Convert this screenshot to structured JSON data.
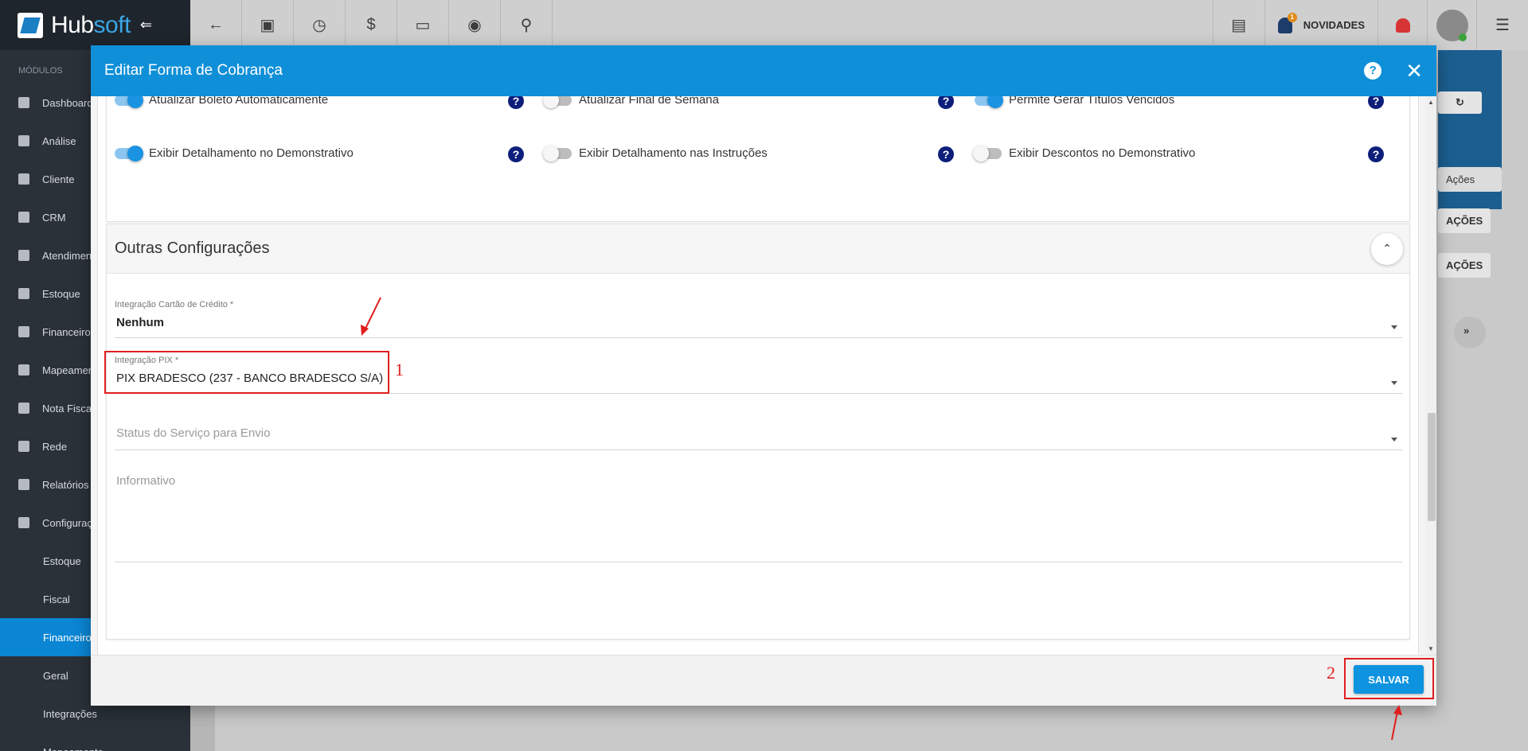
{
  "app": {
    "name_part1": "Hub",
    "name_part2": "soft"
  },
  "sidebar": {
    "section_title": "MÓDULOS",
    "items": [
      {
        "label": "Dashboard",
        "icon": "grid-icon"
      },
      {
        "label": "Análise",
        "icon": "chart-pie-icon"
      },
      {
        "label": "Cliente",
        "icon": "contact-card-icon"
      },
      {
        "label": "CRM",
        "icon": "crm-icon"
      },
      {
        "label": "Atendimento",
        "icon": "calendar-clock-icon"
      },
      {
        "label": "Estoque",
        "icon": "box-icon"
      },
      {
        "label": "Financeiro",
        "icon": "money-icon"
      },
      {
        "label": "Mapeamento",
        "icon": "map-pin-icon"
      },
      {
        "label": "Nota Fiscal",
        "icon": "invoice-icon"
      },
      {
        "label": "Rede",
        "icon": "server-icon"
      },
      {
        "label": "Relatórios",
        "icon": "file-icon"
      },
      {
        "label": "Configurações",
        "icon": "gear-icon"
      }
    ],
    "subitems": [
      {
        "label": "Estoque"
      },
      {
        "label": "Fiscal"
      },
      {
        "label": "Financeiro"
      },
      {
        "label": "Geral"
      },
      {
        "label": "Integrações"
      },
      {
        "label": "Mapeamento"
      }
    ]
  },
  "topbar": {
    "news_label": "NOVIDADES",
    "news_badge": "1"
  },
  "background": {
    "chip_acoes": "Ações",
    "chip_1": "AÇÕES",
    "chip_2": "AÇÕES"
  },
  "modal": {
    "title": "Editar Forma de Cobrança",
    "help": "?",
    "close": "✕",
    "toggles": [
      {
        "label": "Atualizar Boleto Automaticamente",
        "on": true
      },
      {
        "label": "Atualizar Final de Semana",
        "on": false
      },
      {
        "label": "Permite Gerar Títulos Vencidos",
        "on": true
      },
      {
        "label": "Exibir Detalhamento no Demonstrativo",
        "on": true
      },
      {
        "label": "Exibir Detalhamento nas Instruções",
        "on": false
      },
      {
        "label": "Exibir Descontos no Demonstrativo",
        "on": false
      }
    ],
    "help_mark": "?",
    "section_title": "Outras Configurações",
    "fields": {
      "cartao_label": "Integração Cartão de Crédito *",
      "cartao_value": "Nenhum",
      "pix_label": "Integração PIX *",
      "pix_value": "PIX BRADESCO (237 - BANCO BRADESCO S/A)",
      "status_placeholder": "Status do Serviço para Envio",
      "informativo_placeholder": "Informativo"
    },
    "save_label": "SALVAR"
  },
  "annotations": {
    "num1": "1",
    "num2": "2",
    "color": "#e01e1e"
  }
}
